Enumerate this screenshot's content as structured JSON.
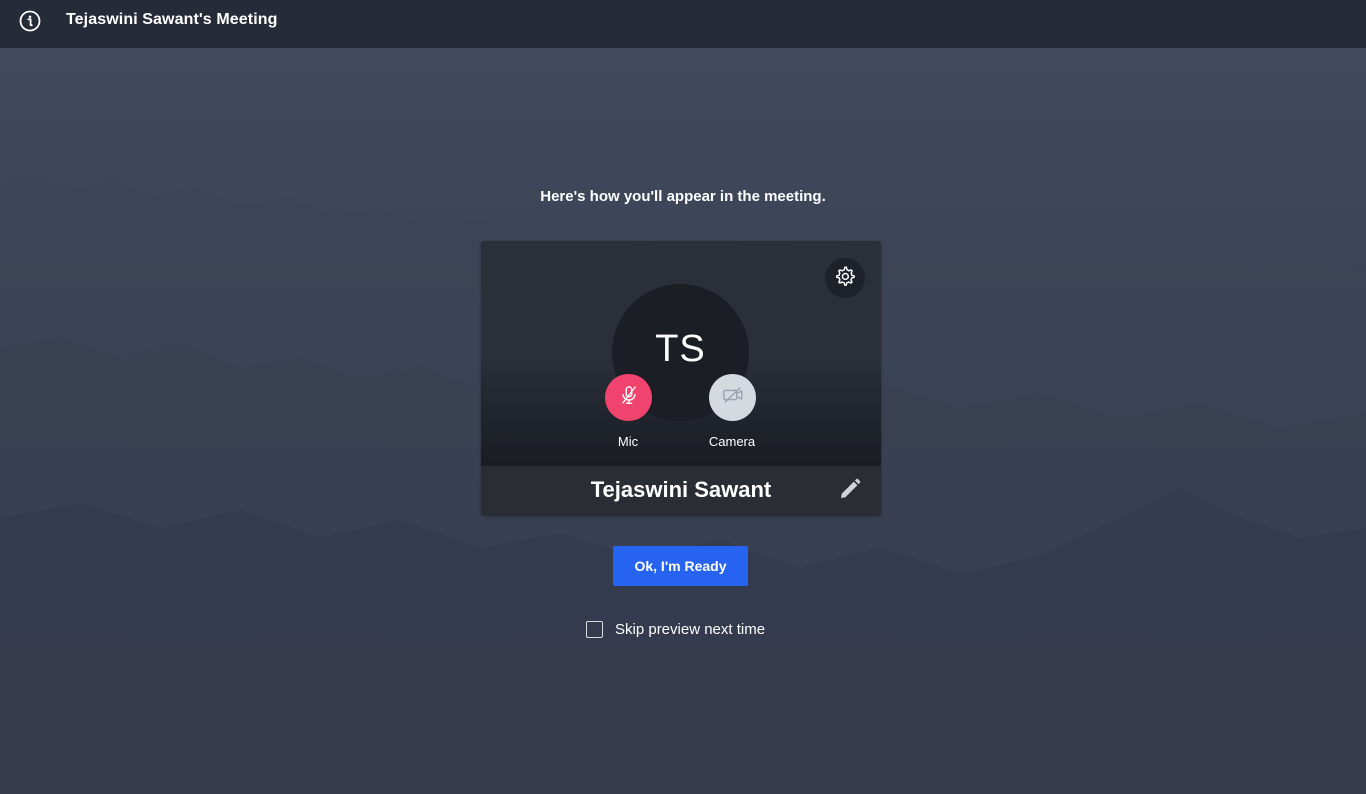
{
  "topbar": {
    "title": "Tejaswini Sawant's Meeting",
    "info_icon": "info-icon"
  },
  "preview": {
    "headline": "Here's how you'll appear in the meeting.",
    "avatar_initials": "TS",
    "mic": {
      "label": "Mic",
      "state": "muted",
      "icon": "mic-off-icon",
      "color": "#f0436e"
    },
    "camera": {
      "label": "Camera",
      "state": "off",
      "icon": "video-off-icon",
      "color": "#d5d9e0"
    },
    "settings_icon": "gear-icon",
    "participant_name": "Tejaswini Sawant",
    "edit_icon": "pencil-icon"
  },
  "actions": {
    "ready_label": "Ok, I'm Ready",
    "ready_color": "#2563f0",
    "skip_label": "Skip preview next time",
    "skip_checked": false
  }
}
